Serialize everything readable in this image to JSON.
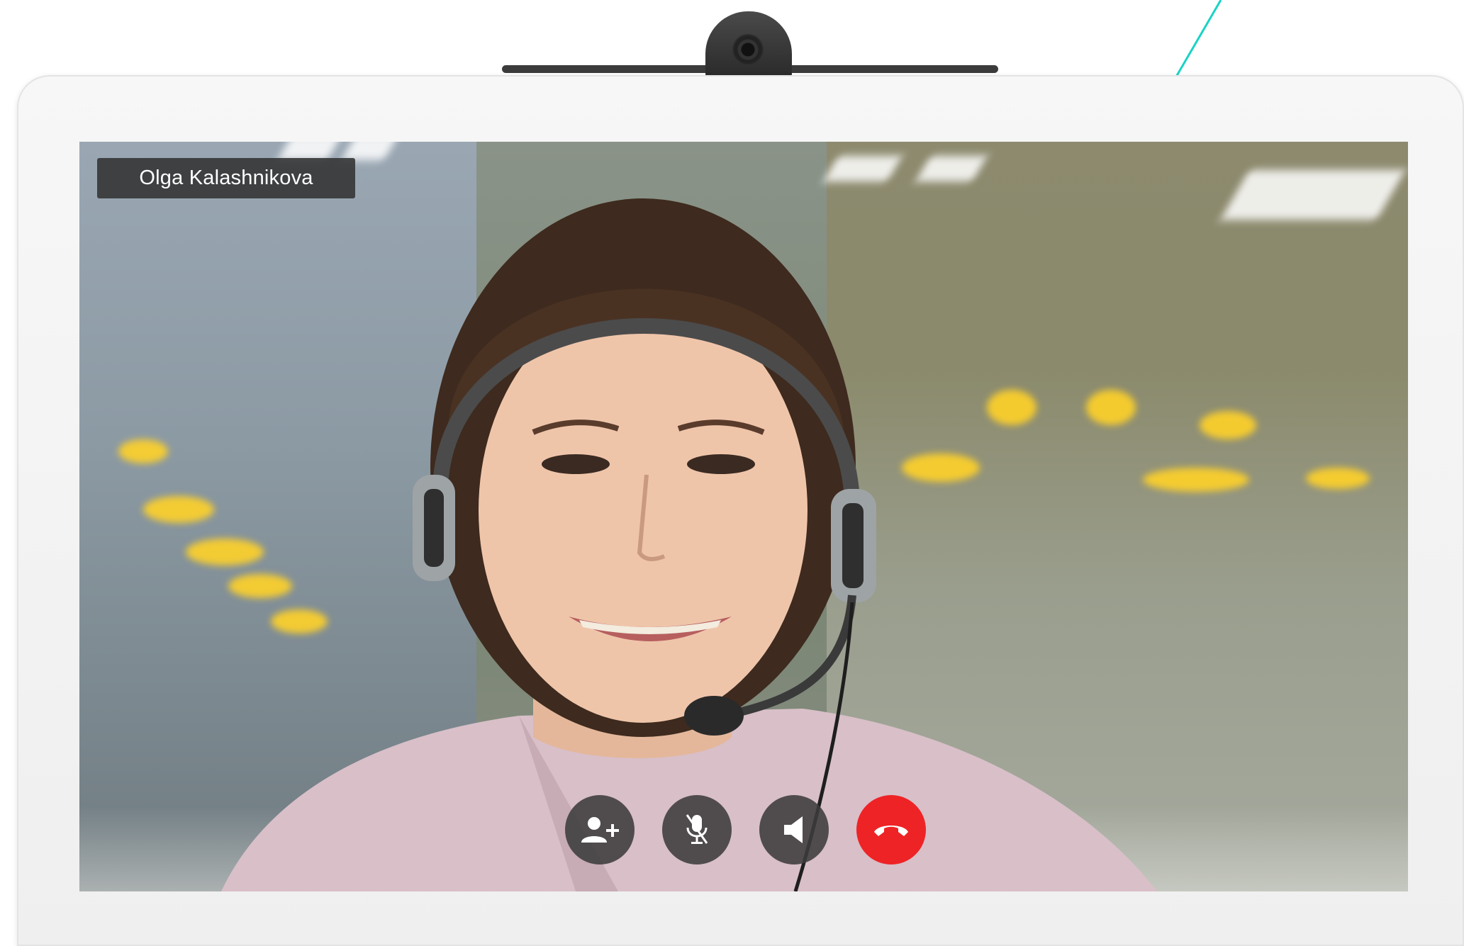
{
  "call": {
    "participant_name": "Olga Kalashnikova"
  },
  "controls": [
    {
      "id": "add-participant",
      "icon": "add-person-icon"
    },
    {
      "id": "mute",
      "icon": "mic-off-icon"
    },
    {
      "id": "speaker",
      "icon": "speaker-icon"
    },
    {
      "id": "end-call",
      "icon": "hang-up-icon"
    }
  ],
  "colors": {
    "end_call": "#ee2326",
    "control_bg": "#3c3c3c",
    "accent_line": "#19d3c5",
    "name_tag_bg": "#323232"
  }
}
